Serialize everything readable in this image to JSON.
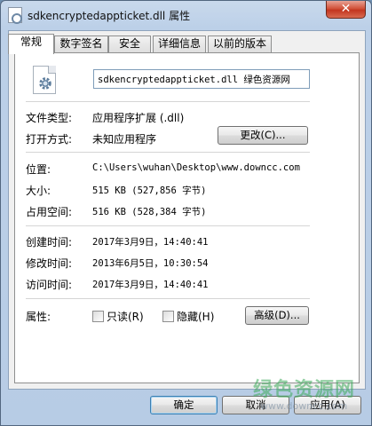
{
  "window": {
    "title": "sdkencryptedappticket.dll 属性",
    "close_label": "✕"
  },
  "tabs": [
    {
      "label": "常规",
      "active": true
    },
    {
      "label": "数字签名",
      "active": false
    },
    {
      "label": "安全",
      "active": false
    },
    {
      "label": "详细信息",
      "active": false
    },
    {
      "label": "以前的版本",
      "active": false
    }
  ],
  "general": {
    "file_icon": "dll-gear-icon",
    "file_name": "sdkencryptedappticket.dll 绿色资源网",
    "file_type_label": "文件类型:",
    "file_type_value": "应用程序扩展 (.dll)",
    "opens_with_label": "打开方式:",
    "opens_with_value": "未知应用程序",
    "change_button": "更改(C)...",
    "location_label": "位置:",
    "location_value": "C:\\Users\\wuhan\\Desktop\\www.downcc.com",
    "size_label": "大小:",
    "size_value": "515 KB (527,856 字节)",
    "size_on_disk_label": "占用空间:",
    "size_on_disk_value": "516 KB (528,384 字节)",
    "created_label": "创建时间:",
    "created_value": "2017年3月9日，14:40:41",
    "modified_label": "修改时间:",
    "modified_value": "2013年6月5日，10:30:54",
    "accessed_label": "访问时间:",
    "accessed_value": "2017年3月9日，14:40:41",
    "attributes_label": "属性:",
    "readonly_label": "只读(R)",
    "readonly_checked": false,
    "hidden_label": "隐藏(H)",
    "hidden_checked": false,
    "advanced_button": "高级(D)..."
  },
  "footer": {
    "ok_button": "确定",
    "cancel_button": "取消",
    "apply_button": "应用(A)"
  },
  "watermark": {
    "main": "绿色资源网",
    "sub": "www.downcc.com"
  },
  "colors": {
    "title_bg": "#bcd0e8",
    "close_red": "#c3361f",
    "default_button_border": "#3c7fb1",
    "watermark_green": "#3caa5a"
  }
}
